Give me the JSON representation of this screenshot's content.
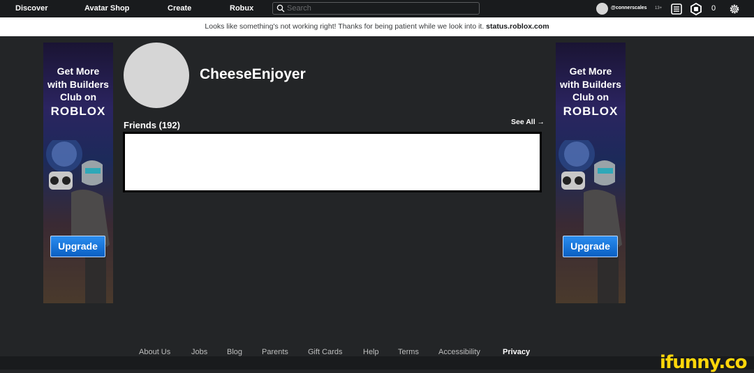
{
  "topbar": {
    "nav": [
      "Discover",
      "Avatar Shop",
      "Create",
      "Robux"
    ],
    "search_placeholder": "Search",
    "username": "@connerscales",
    "age_badge": "13+",
    "robux_count": "0",
    "icons": [
      "search-icon",
      "messages-icon",
      "robux-icon",
      "gear-icon"
    ]
  },
  "alert": {
    "text": "Looks like something's not working right! Thanks for being patient while we look into it.",
    "link": "status.roblox.com"
  },
  "ads": {
    "line1": "Get More",
    "line2": "with Builders",
    "line3": "Club on",
    "logo": "ROBLOX",
    "button": "Upgrade"
  },
  "profile": {
    "name": "CheeseEnjoyer",
    "friends_label": "Friends (192)",
    "see_all": "See All →"
  },
  "footer": {
    "links": [
      "About Us",
      "Jobs",
      "Blog",
      "Parents",
      "Gift Cards",
      "Help",
      "Terms",
      "Accessibility",
      "Privacy"
    ]
  },
  "watermark": "ifunny.co",
  "colors": {
    "background": "#232527",
    "topbar": "#191b1d",
    "upgrade_button": "#0a6ad6"
  }
}
